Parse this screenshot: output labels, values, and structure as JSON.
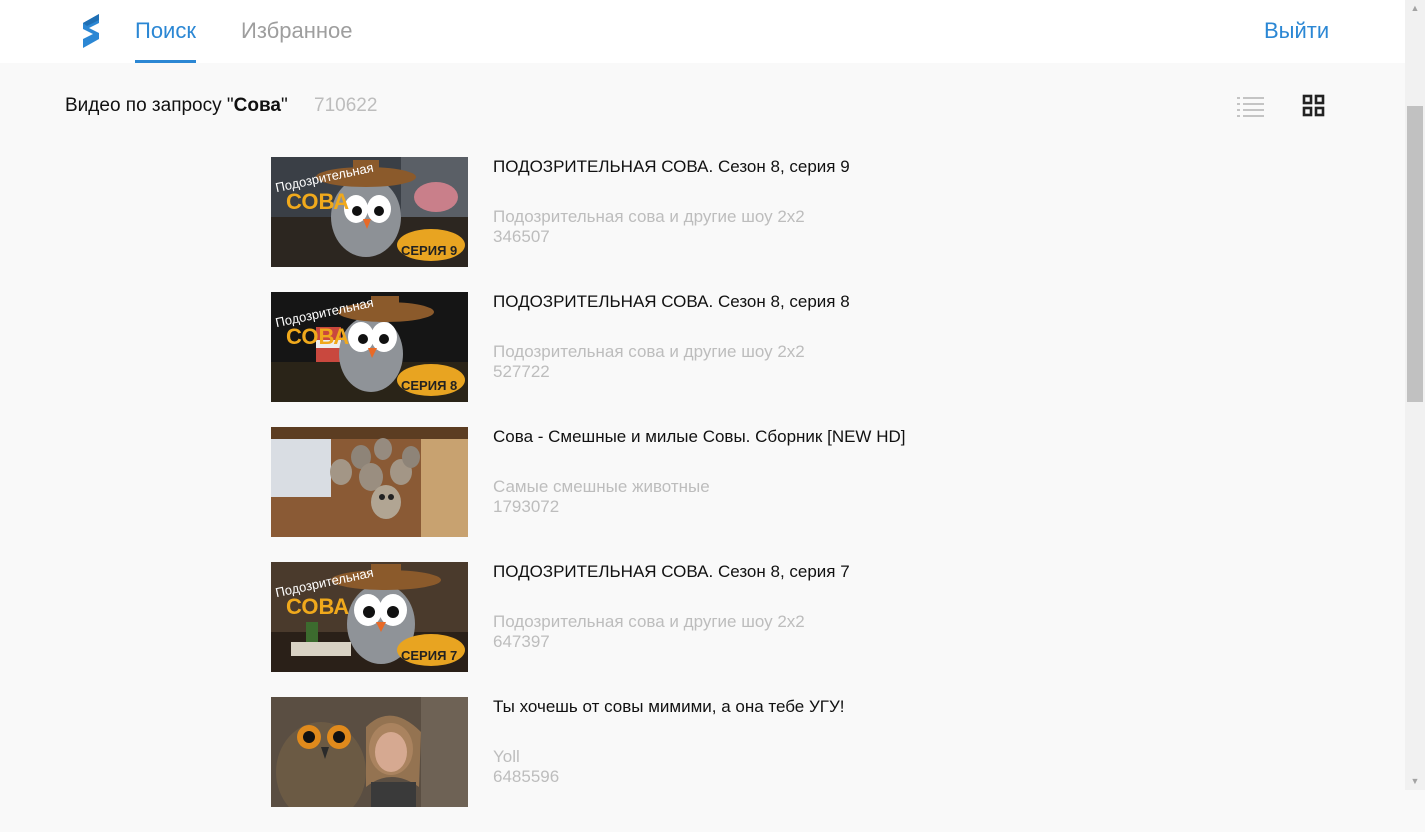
{
  "header": {
    "tabs": [
      {
        "label": "Поиск",
        "active": true
      },
      {
        "label": "Избранное",
        "active": false
      }
    ],
    "logout_label": "Выйти"
  },
  "query": {
    "prefix": "Видео по запросу \"",
    "term": "Сова",
    "suffix": "\"",
    "count": "710622"
  },
  "view_toggle": {
    "list_icon": "list-view-icon",
    "grid_icon": "grid-view-icon"
  },
  "colors": {
    "accent": "#2b87d4",
    "muted": "#bdbdbd",
    "background": "#f9f9f9"
  },
  "videos": [
    {
      "title": "ПОДОЗРИТЕЛЬНАЯ СОВА. Сезон 8, серия 9",
      "channel": "Подозрительная сова и другие шоу 2х2",
      "views": "346507"
    },
    {
      "title": "ПОДОЗРИТЕЛЬНАЯ СОВА. Сезон 8, серия 8",
      "channel": "Подозрительная сова и другие шоу 2х2",
      "views": "527722"
    },
    {
      "title": "Сова - Смешные и милые Совы. Сборник [NEW HD]",
      "channel": "Самые смешные животные",
      "views": "1793072"
    },
    {
      "title": "ПОДОЗРИТЕЛЬНАЯ СОВА. Сезон 8, серия 7",
      "channel": "Подозрительная сова и другие шоу 2х2",
      "views": "647397"
    },
    {
      "title": "Ты хочешь от совы мимими, а она тебе УГУ!",
      "channel": "Yoll",
      "views": "6485596"
    }
  ]
}
